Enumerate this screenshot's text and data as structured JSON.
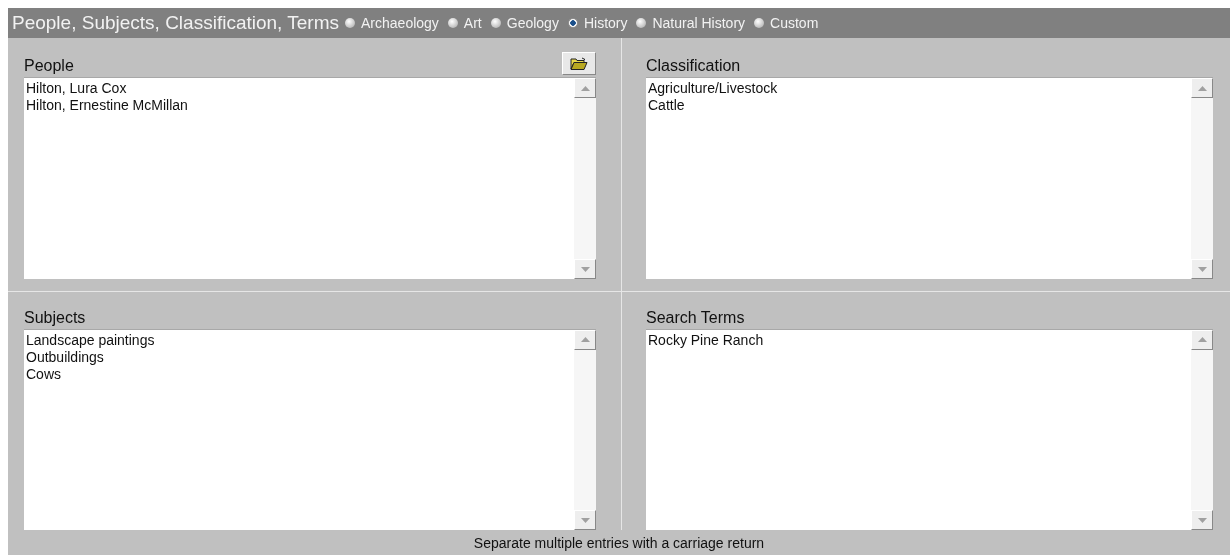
{
  "header": {
    "title": "People, Subjects, Classification, Terms",
    "options": [
      {
        "label": "Archaeology",
        "selected": false
      },
      {
        "label": "Art",
        "selected": false
      },
      {
        "label": "Geology",
        "selected": false
      },
      {
        "label": "History",
        "selected": true
      },
      {
        "label": "Natural History",
        "selected": false
      },
      {
        "label": "Custom",
        "selected": false
      }
    ]
  },
  "panels": [
    {
      "label": "People",
      "has_browse": true,
      "entries": [
        "Hilton, Lura Cox",
        "Hilton, Ernestine McMillan"
      ]
    },
    {
      "label": "Classification",
      "entries": [
        "Agriculture/Livestock",
        "Cattle"
      ]
    },
    {
      "label": "Subjects",
      "entries": [
        "Landscape paintings",
        "Outbuildings",
        "Cows"
      ]
    },
    {
      "label": "Search Terms",
      "entries": [
        "Rocky Pine Ranch"
      ]
    }
  ],
  "footer": "Separate multiple entries with a carriage return"
}
